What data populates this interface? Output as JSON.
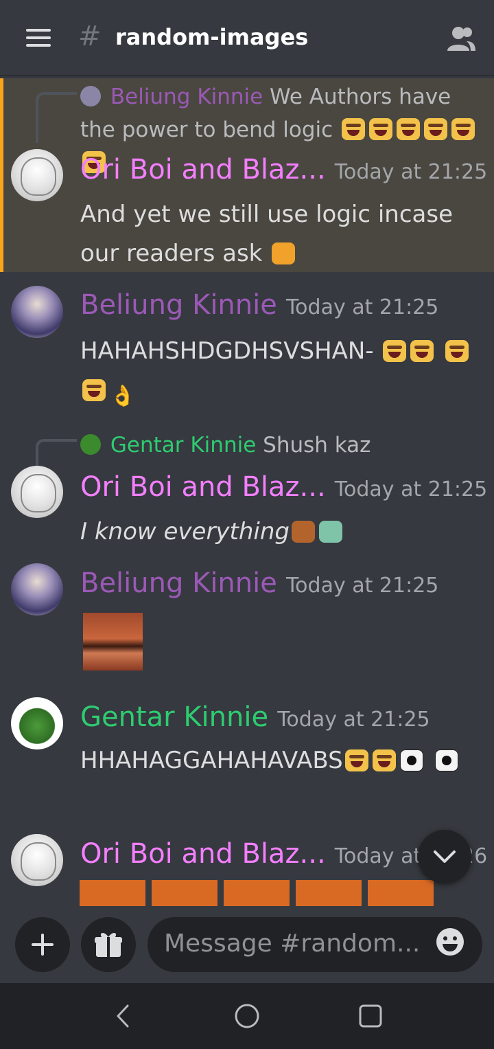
{
  "header": {
    "channel_name": "random-images"
  },
  "messages": [
    {
      "reply": {
        "author": "Beliung Kinnie",
        "text": "We Authors have the power to bend logic"
      },
      "author": "Ori Boi and Blaz...",
      "time": "Today at 21:25",
      "text": "And yet we still use logic incase our readers ask"
    },
    {
      "author": "Beliung Kinnie",
      "time": "Today at 21:25",
      "text": "HAHAHSHDGDHSVSHAN-"
    },
    {
      "reply": {
        "author": "Gentar Kinnie",
        "text": "Shush kaz"
      },
      "author": "Ori Boi and Blaz...",
      "time": "Today at 21:25",
      "text": "I know everything"
    },
    {
      "author": "Beliung Kinnie",
      "time": "Today at 21:25",
      "image": "laughing-man-meme"
    },
    {
      "author": "Gentar Kinnie",
      "time": "Today at 21:25",
      "text": "HHAHAGGAHAHAVABS"
    },
    {
      "author": "Ori Boi and Blaz...",
      "time": "Today at 21:26"
    }
  ],
  "composer": {
    "placeholder": "Message #random..."
  },
  "icons": [
    "hamburger-icon",
    "hash-icon",
    "members-icon",
    "plus-icon",
    "gift-icon",
    "emoji-icon",
    "chevron-down-icon",
    "back-icon",
    "home-icon",
    "recents-icon"
  ],
  "colors": {
    "ori": "#f47fff",
    "beliung": "#9b59b6",
    "gentar": "#2ecc71",
    "mention_bar": "#faa61a",
    "background": "#36393f"
  }
}
